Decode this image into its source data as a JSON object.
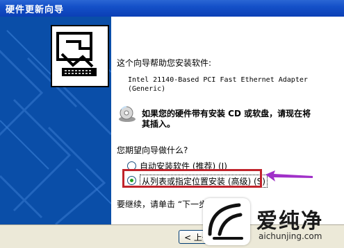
{
  "window": {
    "title": "硬件更新向导"
  },
  "wizard": {
    "intro": "这个向导帮助您安装软件:",
    "device_name": "Intel 21140-Based PCI Fast Ethernet Adapter",
    "device_variant": "(Generic)",
    "cd_prompt_line1": "如果您的硬件带有安装 CD 或软盘，请现在将",
    "cd_prompt_line2": "其插入。",
    "question": "您期望向导做什么?",
    "options": [
      {
        "label": "自动安装软件 (推荐) (I)",
        "selected": false
      },
      {
        "label": "从列表或指定位置安装 (高级) (S)",
        "selected": true
      }
    ],
    "continue_text": "要继续，请单击 “下一步”。"
  },
  "buttons": {
    "back_label": "< 上一"
  },
  "watermark": {
    "brand": "爱纯净",
    "url": "aichunjing.com"
  },
  "colors": {
    "titlebar": "#0b3fb5",
    "side_panel": "#0a4ea8",
    "highlight": "#c0232b",
    "arrow": "#a030c8"
  }
}
